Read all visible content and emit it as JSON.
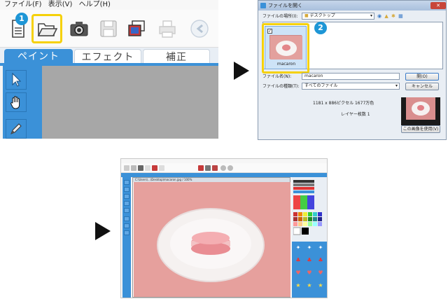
{
  "step1": {
    "menu": [
      {
        "label": "ファイル(F)"
      },
      {
        "label": "表示(V)"
      },
      {
        "label": "ヘルプ(H)"
      }
    ],
    "toolbar_icons": [
      "new-document-icon",
      "open-folder-icon",
      "camera-icon",
      "save-icon",
      "gallery-icon",
      "print-icon",
      "undo-icon"
    ],
    "badge": "1",
    "tabs": [
      {
        "label": "ペイント",
        "active": true
      },
      {
        "label": "エフェクト",
        "active": false
      },
      {
        "label": "補正",
        "active": false
      }
    ],
    "tools": [
      "select-arrow-icon",
      "hand-icon",
      "pen-icon"
    ],
    "colors": {
      "accent": "#3b91d8",
      "highlight": "#f5d10a",
      "badge": "#1e96d6",
      "canvas": "#a7a7a7"
    }
  },
  "dialog": {
    "title": "ファイルを開く",
    "location_label": "ファイルの場所(I):",
    "location_value": "デスクトップ",
    "badge": "2",
    "file": {
      "name": "macaron",
      "checked": true
    },
    "filename_label": "ファイル名(N):",
    "filename_value": "macaron",
    "filetype_label": "ファイルの種類(T):",
    "filetype_value": "すべてのファイル",
    "open_button": "開(O)",
    "cancel_button": "キャンセル",
    "info_size": "1181 x 886ピクセル 1677万色",
    "info_layers": "レイヤー枚数 1",
    "use_image_button": "この画像を使用(V)"
  },
  "step3": {
    "window_title": "C:\\Users\\...\\Desktop\\macaron.jpg / 100%",
    "image_desc_icon": "macaron-photo"
  }
}
